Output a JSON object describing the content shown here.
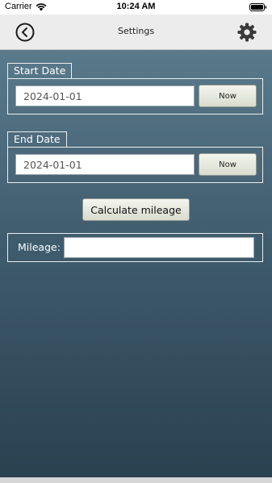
{
  "status_bar": {
    "carrier": "Carrier",
    "time": "10:24 AM",
    "wifi_icon": "wifi-icon",
    "battery_icon": "battery-icon"
  },
  "nav_bar": {
    "title": "Settings",
    "back_icon": "chevron-left-circle-icon",
    "settings_icon": "gear-icon"
  },
  "start_date": {
    "label": "Start Date",
    "value": "2024-01-01",
    "now_label": "Now"
  },
  "end_date": {
    "label": "End Date",
    "value": "2024-01-01",
    "now_label": "Now"
  },
  "calculate": {
    "label": "Calculate mileage"
  },
  "mileage": {
    "label": "Mileage:",
    "value": ""
  },
  "colors": {
    "background_top": "#5a7a8c",
    "background_bottom": "#2a4150",
    "nav_bar": "#ececec",
    "group_border": "#e9eef1",
    "button_face": "#e3e6da"
  }
}
